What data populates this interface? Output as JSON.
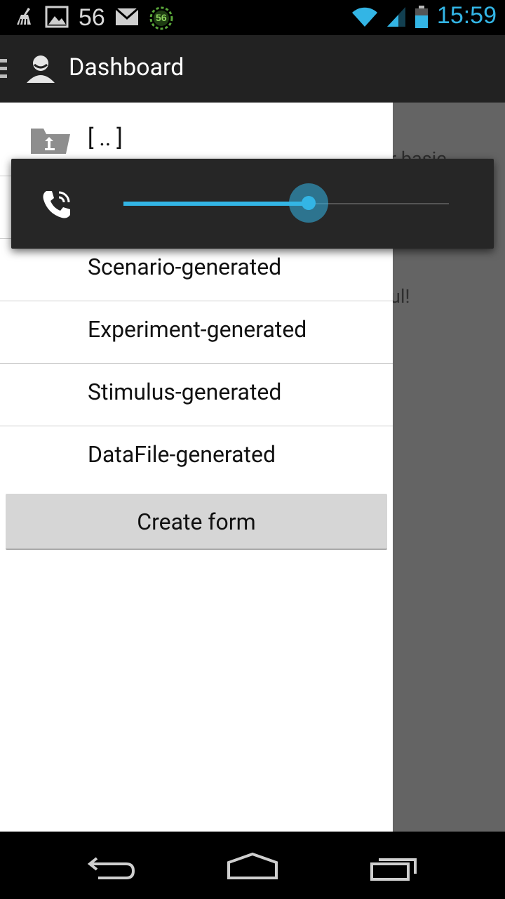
{
  "status_bar": {
    "notification_count": "56",
    "badge_count": "56",
    "time": "15:59",
    "time_color": "#33b5e5",
    "icons_left": [
      "cleaner-icon",
      "image-icon",
      "mail-icon",
      "badge-icon"
    ],
    "icons_right": [
      "wifi-icon",
      "signal-icon",
      "battery-icon"
    ]
  },
  "action_bar": {
    "title": "Dashboard",
    "icon": "person-icon"
  },
  "background": {
    "text_line_1": "r basic",
    "text_line_2": "ul!"
  },
  "drawer": {
    "items": [
      {
        "label": "[ .. ]",
        "icon": "folder-up-icon"
      },
      {
        "label": ""
      },
      {
        "label": "Scenario-generated"
      },
      {
        "label": "Experiment-generated"
      },
      {
        "label": "Stimulus-generated"
      },
      {
        "label": "DataFile-generated"
      }
    ],
    "create_button": "Create form"
  },
  "volume_popup": {
    "stream_icon": "phone-ring-icon",
    "level": 0.57,
    "accent": "#33b5e5"
  },
  "nav_bar": {
    "buttons": [
      "back-icon",
      "home-icon",
      "recent-apps-icon"
    ]
  }
}
